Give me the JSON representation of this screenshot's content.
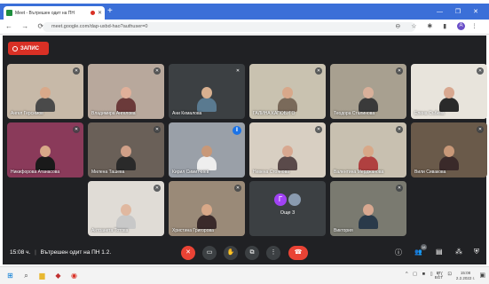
{
  "browser": {
    "tab_title": "Meet - Вътрешен одит на ПН",
    "tab_close": "✕",
    "new_tab": "+",
    "window_controls": "— ❐ ✕",
    "url": "meet.google.com/dap-uxbd-hao?authuser=0",
    "profile_initial": "A"
  },
  "meet": {
    "record_label": "ЗАПИС",
    "participants": [
      {
        "name": "Ангел Герсимов",
        "bg": "#c7b9a8",
        "skin": "#d9a98a",
        "shirt": "#4a4a4a",
        "mic": "muted"
      },
      {
        "name": "Владимира Ангелова",
        "bg": "#b8a89c",
        "skin": "#e0b09a",
        "shirt": "#6b3a3a",
        "mic": "muted"
      },
      {
        "name": "Ани Кемалова",
        "bg": "#3c4043",
        "skin": "#d8b090",
        "shirt": "#5a7a90",
        "mic": "muted"
      },
      {
        "name": "ГАЛИНА КАПОБУГО",
        "bg": "#c9c2b0",
        "skin": "#d8a88a",
        "shirt": "#7a6a5a",
        "mic": "muted"
      },
      {
        "name": "Теодора Сталинова",
        "bg": "#a8a090",
        "skin": "#d9b09a",
        "shirt": "#3a3a3a",
        "mic": "muted"
      },
      {
        "name": "Елена Събева",
        "bg": "#e8e4dc",
        "skin": "#d8a890",
        "shirt": "#2a2a2a",
        "mic": "muted"
      },
      {
        "name": "Никифорова Атанасова",
        "bg": "#8a3a5a",
        "skin": "#d8a888",
        "shirt": "#1a1a1a",
        "mic": "muted"
      },
      {
        "name": "Милена Ташева",
        "bg": "#6a6058",
        "skin": "#d0a088",
        "shirt": "#2a2a2a",
        "mic": "muted"
      },
      {
        "name": "Кирил Симитчиев",
        "bg": "#9aa0a8",
        "skin": "#c89878",
        "shirt": "#eeeeee",
        "mic": "speaking"
      },
      {
        "name": "Невена Стоянова",
        "bg": "#d8cfc2",
        "skin": "#d8a890",
        "shirt": "#5a4a4a",
        "mic": "muted"
      },
      {
        "name": "Валентина Мерджанова",
        "bg": "#c8c0b0",
        "skin": "#d8a888",
        "shirt": "#b04040",
        "mic": "muted"
      },
      {
        "name": "Вили Сивакова",
        "bg": "#6a5a4a",
        "skin": "#c89878",
        "shirt": "#3a2a2a",
        "mic": "muted"
      },
      {
        "name": "Антоанета Тотова",
        "bg": "#e0dcd6",
        "skin": "#e0b8a0",
        "shirt": "#c8c8c8",
        "mic": "muted"
      },
      {
        "name": "Христина Григорова",
        "bg": "#9a8a78",
        "skin": "#d8a888",
        "shirt": "#3a2a2a",
        "mic": "muted"
      },
      {
        "name": "Виктория",
        "bg": "#7a7a70",
        "skin": "#d8a890",
        "shirt": "#2a3a4a",
        "mic": "muted"
      }
    ],
    "group_tile": {
      "initial": "Г",
      "label": "Още 3"
    },
    "mic_glyph": "✕",
    "speaking_glyph": "⦀"
  },
  "controls": {
    "time": "15:08 ч.",
    "separator": "|",
    "meeting_title": "Вътрешен одит на ПН 1.2.",
    "mic_glyph": "✕",
    "camera_glyph": "▭",
    "hand_glyph": "✋",
    "present_glyph": "⧉",
    "more_glyph": "⋮",
    "end_glyph": "☎",
    "info_glyph": "ⓘ",
    "people_glyph": "👥",
    "people_count": "18",
    "chat_glyph": "▤",
    "activities_glyph": "⁂",
    "lock_glyph": "⛨"
  },
  "taskbar": {
    "start_glyph": "⊞",
    "search_glyph": "⌕",
    "explorer_glyph": "▆",
    "app_glyph": "◆",
    "chrome_glyph": "◉",
    "tray_text": "^ ▢ ■ ▯ (( ⊡",
    "lang_top": "БГ",
    "lang_bottom": "BGT",
    "clock_time": "15:08",
    "clock_date": "2.2.2022 г.",
    "notif_glyph": "▣"
  },
  "colors": {
    "chrome_blue": "#3b6fd8",
    "meet_bg": "#202124",
    "record_red": "#d93025",
    "end_red": "#ea4335",
    "speaking_blue": "#1a73e8"
  }
}
